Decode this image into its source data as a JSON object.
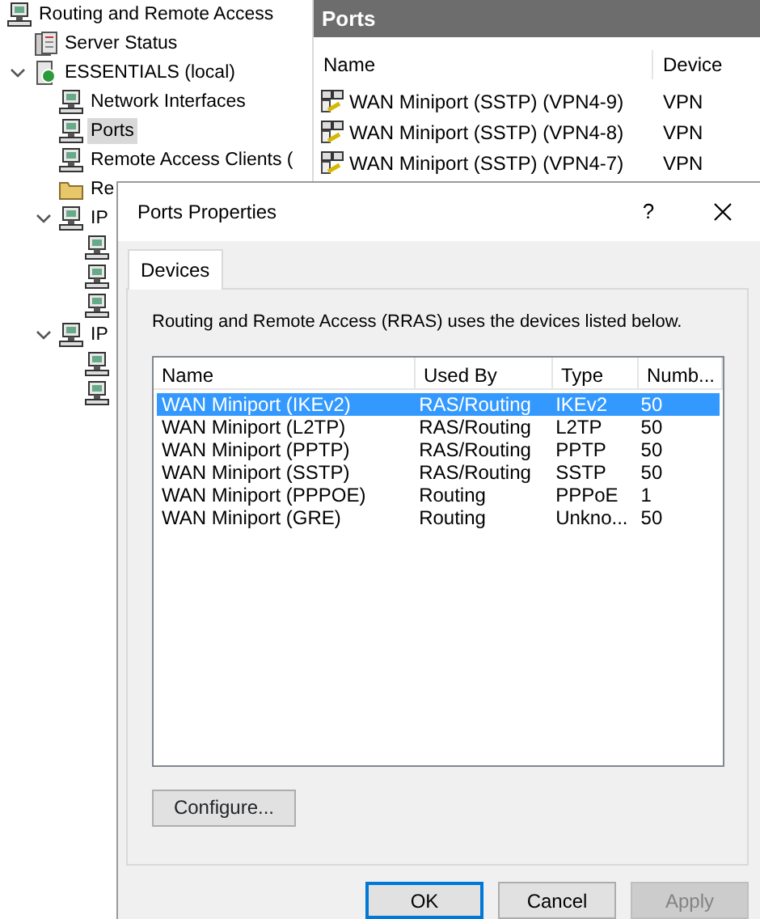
{
  "tree": {
    "label": "Routing and Remote Access",
    "kind": "computer",
    "selected": false,
    "children": [
      {
        "label": "Server Status",
        "kind": "servers",
        "selected": false
      },
      {
        "label": "ESSENTIALS (local)",
        "kind": "server",
        "selected": false,
        "expanded": true,
        "children": [
          {
            "label": "Network Interfaces",
            "kind": "computer",
            "selected": false
          },
          {
            "label": "Ports",
            "kind": "computer",
            "selected": true
          },
          {
            "label": "Remote Access Clients (",
            "kind": "computer",
            "selected": false
          },
          {
            "label": "Re",
            "kind": "folder",
            "selected": false
          },
          {
            "label": "IP",
            "kind": "computer",
            "selected": false,
            "expanded": true,
            "children": [
              {
                "kind": "computer"
              },
              {
                "kind": "computer"
              },
              {
                "kind": "computer"
              }
            ]
          },
          {
            "label": "IP",
            "kind": "computer",
            "selected": false,
            "expanded": true,
            "children": [
              {
                "kind": "computer"
              },
              {
                "kind": "computer"
              }
            ]
          }
        ]
      }
    ]
  },
  "ports_pane": {
    "title": "Ports",
    "columns": [
      "Name",
      "Device"
    ],
    "rows": [
      {
        "name": "WAN Miniport (SSTP) (VPN4-9)",
        "device": "VPN"
      },
      {
        "name": "WAN Miniport (SSTP) (VPN4-8)",
        "device": "VPN"
      },
      {
        "name": "WAN Miniport (SSTP) (VPN4-7)",
        "device": "VPN"
      }
    ]
  },
  "dialog": {
    "title": "Ports Properties",
    "help": "?",
    "tabs": [
      {
        "label": "Devices",
        "selected": true
      }
    ],
    "description": "Routing and Remote Access (RRAS) uses the devices listed below.",
    "columns": [
      "Name",
      "Used By",
      "Type",
      "Numb..."
    ],
    "rows": [
      {
        "cells": [
          "WAN Miniport (IKEv2)",
          "RAS/Routing",
          "IKEv2",
          "50"
        ],
        "selected": true
      },
      {
        "cells": [
          "WAN Miniport (L2TP)",
          "RAS/Routing",
          "L2TP",
          "50"
        ],
        "selected": false
      },
      {
        "cells": [
          "WAN Miniport (PPTP)",
          "RAS/Routing",
          "PPTP",
          "50"
        ],
        "selected": false
      },
      {
        "cells": [
          "WAN Miniport (SSTP)",
          "RAS/Routing",
          "SSTP",
          "50"
        ],
        "selected": false
      },
      {
        "cells": [
          "WAN Miniport (PPPOE)",
          "Routing",
          "PPPoE",
          "1"
        ],
        "selected": false
      },
      {
        "cells": [
          "WAN Miniport (GRE)",
          "Routing",
          "Unkno...",
          "50"
        ],
        "selected": false
      }
    ],
    "configure_button": "Configure...",
    "buttons": [
      {
        "label": "OK",
        "default": true,
        "disabled": false
      },
      {
        "label": "Cancel",
        "default": false,
        "disabled": false
      },
      {
        "label": "Apply",
        "default": false,
        "disabled": true
      }
    ]
  }
}
